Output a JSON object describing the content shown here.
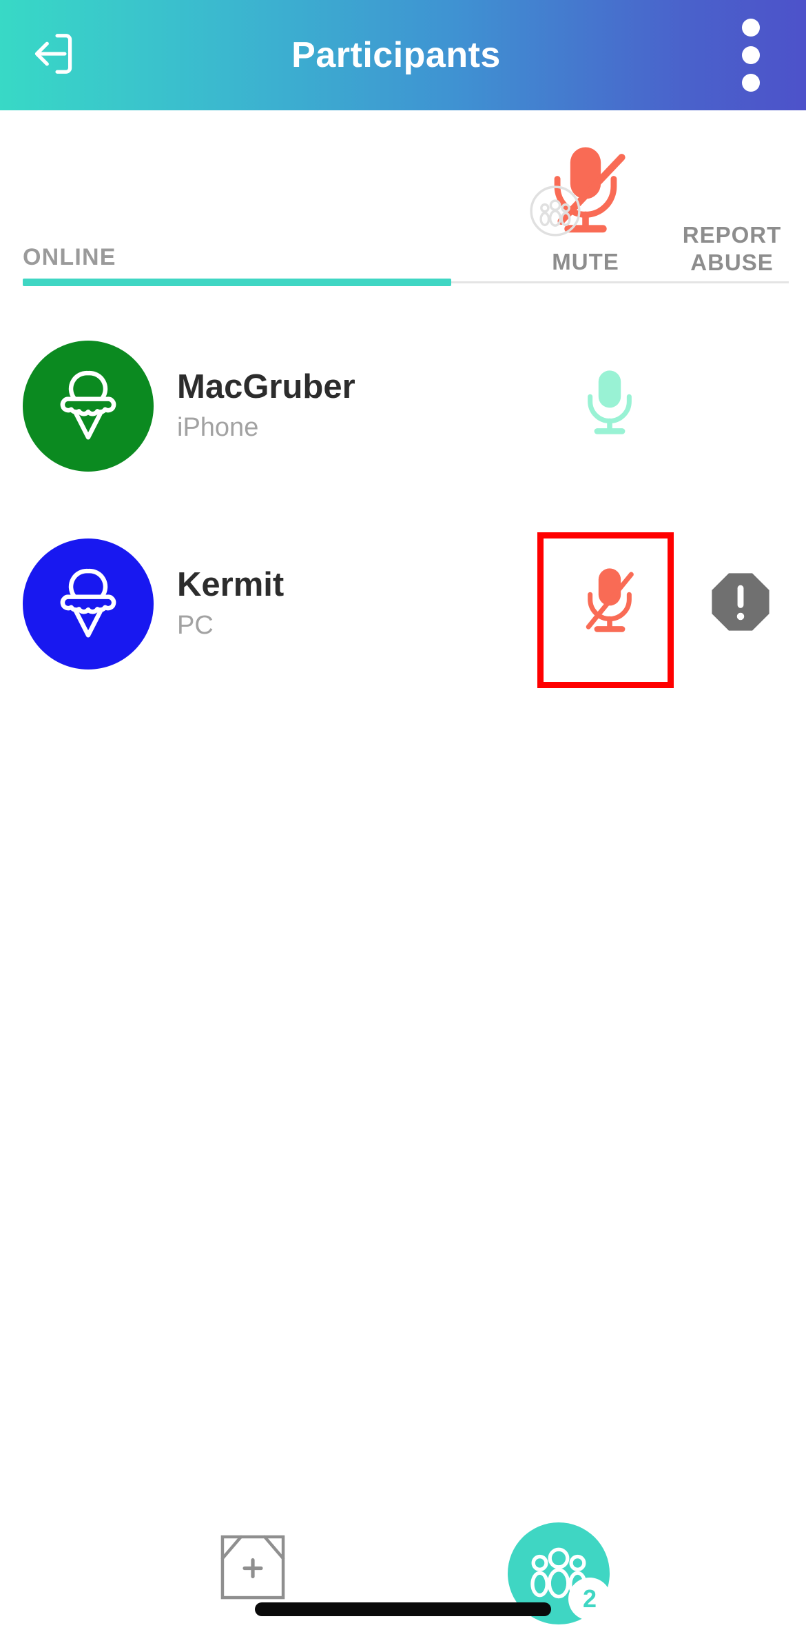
{
  "appbar": {
    "title": "Participants",
    "back_icon": "exit-arrow-icon",
    "overflow_icon": "more-vertical-icon"
  },
  "tabs": {
    "online_label": "ONLINE",
    "mute_all_label": "MUTE",
    "report_abuse_label_line1": "REPORT",
    "report_abuse_label_line2": "ABUSE",
    "mute_all_icon": "mute-all-microphone-icon",
    "active_underline_color": "#3fd6c3"
  },
  "participants": [
    {
      "name": "MacGruber",
      "device": "iPhone",
      "avatar_color": "#0b8a20",
      "avatar_icon": "ice-cream-cone-icon",
      "mic_state": "unmuted",
      "mic_icon": "microphone-icon",
      "mic_color": "#99f2d4",
      "has_report": false
    },
    {
      "name": "Kermit",
      "device": "PC",
      "avatar_color": "#1818f0",
      "avatar_icon": "ice-cream-cone-icon",
      "mic_state": "muted",
      "mic_icon": "microphone-muted-icon",
      "mic_color": "#f96b55",
      "has_report": true,
      "report_icon": "report-abuse-octagon-icon",
      "report_color": "#707070"
    }
  ],
  "annotation": {
    "color": "#ff0000",
    "target": "kermit-mute-toggle"
  },
  "bottombar": {
    "share_screen_icon": "add-screen-share-icon",
    "participants_fab_icon": "group-people-icon",
    "participants_count": "2",
    "fab_color": "#3fd6c3"
  },
  "colors": {
    "header_gradient_start": "#38d9c6",
    "header_gradient_end": "#4d52ca",
    "accent_teal": "#3fd6c3",
    "muted_red": "#f96b55"
  }
}
